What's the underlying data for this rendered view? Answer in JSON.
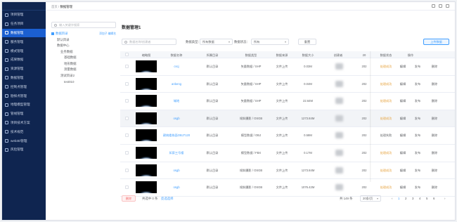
{
  "nav": {
    "items": [
      {
        "label": "项目管理",
        "active": false
      },
      {
        "label": "任务项目",
        "active": false
      },
      {
        "label": "数据管理",
        "active": true
      },
      {
        "label": "服务管理",
        "active": false
      },
      {
        "label": "模式管理",
        "active": false
      },
      {
        "label": "成果数据",
        "active": false
      },
      {
        "label": "资源管理",
        "active": false
      },
      {
        "label": "数据管理",
        "active": false
      },
      {
        "label": "控制点管理",
        "active": false
      },
      {
        "label": "勘探点管理",
        "active": false
      },
      {
        "label": "地理模型管理",
        "active": false
      },
      {
        "label": "管线管理",
        "active": false
      },
      {
        "label": "项目技术方案",
        "active": false
      },
      {
        "label": "技术规范",
        "active": false
      },
      {
        "label": "web3D管理",
        "active": false
      },
      {
        "label": "风险管理",
        "active": false
      }
    ]
  },
  "breadcrumb": {
    "home": "首页",
    "sep": "/",
    "current": "数据管理"
  },
  "tree": {
    "search_placeholder": "输入关键字搜索",
    "root": {
      "label": "数据目录",
      "actions": "添加子  编辑名"
    },
    "nodes": [
      {
        "label": "默认目录",
        "level": 1
      },
      {
        "label": "数据中心",
        "level": 1
      },
      {
        "label": "业务数据",
        "level": 2
      },
      {
        "label": "基础数据",
        "level": 3
      },
      {
        "label": "地形数据",
        "level": 3
      },
      {
        "label": "测量数据",
        "level": 3
      },
      {
        "label": "测试目录2",
        "level": 2
      },
      {
        "label": "test010",
        "level": 3
      }
    ]
  },
  "main": {
    "title": "数据管理1",
    "filters": {
      "search_placeholder": "数据名称/创建者",
      "type_label": "数据类型：",
      "type_value": "所有数据",
      "status_label": "数据状态：",
      "status_value": "所有",
      "reset_label": "重置",
      "upload_label": "上传数据"
    },
    "columns": [
      "缩略图",
      "数据名称",
      "所属目录",
      "数据类型",
      "数据来源",
      "数据大小",
      "创建者",
      "20",
      "数据状态",
      "操作"
    ],
    "actions": {
      "edit": "编辑",
      "publish": "发布",
      "delete": "删除"
    },
    "rows": [
      {
        "name": "cscj",
        "dir": "默认目录",
        "type": "矢量数据 / SHP",
        "source": "文件上传",
        "size": "0.03M",
        "date": "202",
        "status": "处理成功",
        "status_color": "#e6a23c"
      },
      {
        "name": "anbeng",
        "dir": "默认目录",
        "type": "矢量数据 / SHP",
        "source": "文件上传",
        "size": "0.04M",
        "date": "202",
        "status": "处理成功",
        "status_color": "#e6a23c"
      },
      {
        "name": "城地",
        "dir": "默认目录",
        "type": "矢量数据 / SHP",
        "source": "文件上传",
        "size": "22.64M",
        "date": "202",
        "status": "处理成功",
        "status_color": "#e6a23c"
      },
      {
        "name": "osgb",
        "dir": "默认目录",
        "type": "倾斜摄影 / OSGB",
        "source": "文件上传",
        "size": "1273.84M",
        "date": "202",
        "status": "处理成功",
        "status_color": "#e6a23c"
      },
      {
        "name": "建筑楼栋面OBJ7120",
        "dir": "默认目录",
        "type": "模型数据 / OBJ",
        "source": "文件上传",
        "size": "0.58M",
        "date": "202",
        "status": "处理失败",
        "status_color": "#606266"
      },
      {
        "name": "如家三号楼",
        "dir": "默认目录",
        "type": "模型数据 / FBX",
        "source": "文件上传",
        "size": "0.17M",
        "date": "202",
        "status": "处理成功",
        "status_color": "#e6a23c"
      },
      {
        "name": "osgb",
        "dir": "默认目录",
        "type": "倾斜摄影 / OSGB",
        "source": "文件上传",
        "size": "1273.84M",
        "date": "202",
        "status": "处理成功",
        "status_color": "#e6a23c"
      },
      {
        "name": "osgb",
        "dir": "默认目录",
        "type": "倾斜摄影 / OSGB",
        "source": "文件上传",
        "size": "1076.42M",
        "date": "202",
        "status": "处理成功",
        "status_color": "#e6a23c"
      }
    ],
    "footer": {
      "delete_label": "删除",
      "selected_text": "共选中 0 条",
      "invert_label": "反选选择",
      "total": "共 149 条",
      "page_size": "20条/页",
      "pages": [
        "1",
        "2",
        "3",
        "4",
        "5",
        "6"
      ],
      "current_page": "1"
    }
  }
}
